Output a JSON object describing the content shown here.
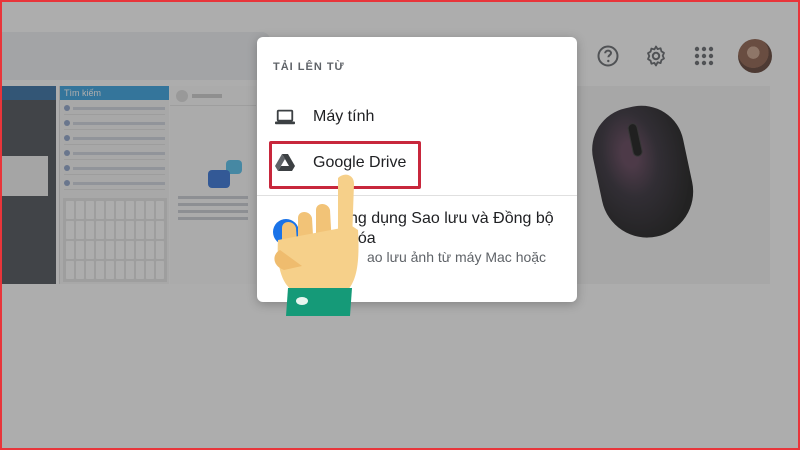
{
  "menu": {
    "heading": "TẢI LÊN TỪ",
    "items": [
      {
        "label": "Máy tính",
        "icon": "laptop-icon"
      },
      {
        "label": "Google Drive",
        "icon": "google-drive-icon"
      }
    ],
    "backup": {
      "title": "ng dụng Sao lưu và Đồng bộ\nhóa",
      "subtitle": "ao lưu ảnh từ máy Mac hoặc"
    }
  },
  "topbar": {
    "icons": [
      "help-icon",
      "gear-icon",
      "apps-grid-icon",
      "avatar"
    ]
  },
  "gallery": {
    "phone_header": "Tìm kiếm"
  },
  "colors": {
    "frame": "#e8353a",
    "highlight": "#c8273c",
    "hand_skin": "#f6d08a",
    "hand_cuff": "#159a78"
  }
}
